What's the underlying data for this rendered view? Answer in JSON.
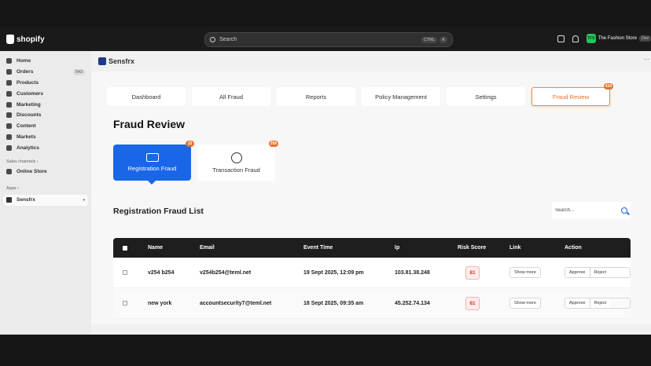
{
  "shopify": {
    "logo_text": "shopify",
    "search_placeholder": "Search",
    "search_kbd": [
      "CTRL",
      "K"
    ],
    "store_initials": "TFS",
    "store_name": "The Fashion Store",
    "store_extra": "Dev"
  },
  "sidebar": {
    "items": [
      {
        "label": "Home",
        "icon": "home-icon"
      },
      {
        "label": "Orders",
        "icon": "orders-icon",
        "badge": "543"
      },
      {
        "label": "Products",
        "icon": "tag-icon"
      },
      {
        "label": "Customers",
        "icon": "person-icon"
      },
      {
        "label": "Marketing",
        "icon": "target-icon"
      },
      {
        "label": "Discounts",
        "icon": "discount-icon"
      },
      {
        "label": "Content",
        "icon": "content-icon"
      },
      {
        "label": "Markets",
        "icon": "globe-icon"
      },
      {
        "label": "Analytics",
        "icon": "chart-icon"
      }
    ],
    "sales_channels_label": "Sales channels",
    "online_store_label": "Online Store",
    "apps_label": "Apps",
    "app_label": "Sensfrx"
  },
  "app": {
    "title": "Sensfrx",
    "tabs": [
      {
        "label": "Dashboard"
      },
      {
        "label": "All Fraud"
      },
      {
        "label": "Reports"
      },
      {
        "label": "Policy Management"
      },
      {
        "label": "Settings"
      },
      {
        "label": "Fraud Review",
        "count": "434",
        "active": true
      }
    ],
    "page_title": "Fraud Review",
    "fraud_tabs": [
      {
        "label": "Registration Fraud",
        "count": "15",
        "active": true
      },
      {
        "label": "Transaction Fraud",
        "count": "299"
      }
    ],
    "list_title": "Registration Fraud List",
    "table_search_placeholder": "Search...",
    "table": {
      "headers": [
        "Name",
        "Email",
        "Event Time",
        "Ip",
        "Risk Score",
        "Link",
        "Action"
      ],
      "rows": [
        {
          "name": "v254 b254",
          "email": "v254b254@teml.net",
          "time": "19 Sept 2025, 12:09 pm",
          "ip": "103.81.38.248",
          "risk": "81",
          "link": "Show more",
          "approve": "Approve",
          "reject": "Reject"
        },
        {
          "name": "new york",
          "email": "accountsecurity7@teml.net",
          "time": "18 Sept 2025, 09:35 am",
          "ip": "45.252.74.134",
          "risk": "81",
          "link": "Show more",
          "approve": "Approve",
          "reject": "Reject"
        }
      ]
    }
  },
  "colors": {
    "accent_orange": "#e8712a",
    "primary_blue": "#1a66e8",
    "risk_red": "#d9352b"
  }
}
